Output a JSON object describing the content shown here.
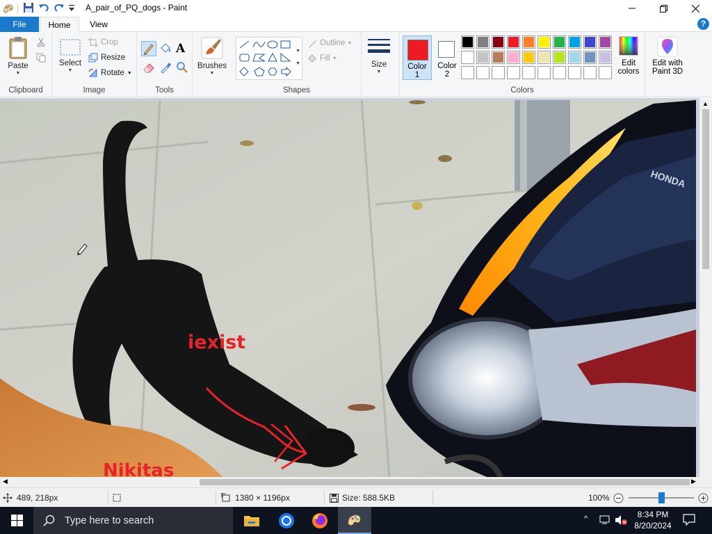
{
  "window": {
    "title": "A_pair_of_PQ_dogs - Paint"
  },
  "tabs": {
    "file": "File",
    "home": "Home",
    "view": "View",
    "help": "?"
  },
  "ribbon": {
    "clipboard": {
      "paste": "Paste",
      "group": "Clipboard"
    },
    "image": {
      "select": "Select",
      "crop": "Crop",
      "resize": "Resize",
      "rotate": "Rotate",
      "group": "Image"
    },
    "tools": {
      "group": "Tools",
      "text_tool": "A"
    },
    "brushes": {
      "label": "Brushes"
    },
    "shapes": {
      "outline": "Outline",
      "fill": "Fill",
      "group": "Shapes"
    },
    "size": {
      "label": "Size"
    },
    "colors": {
      "color1": "Color\n1",
      "color1_line1": "Color",
      "color1_line2": "1",
      "color2_line1": "Color",
      "color2_line2": "2",
      "edit_colors_line1": "Edit",
      "edit_colors_line2": "colors",
      "group": "Colors",
      "color1_value": "#ed1c24",
      "color2_value": "#ffffff",
      "palette_row1": [
        "#000000",
        "#7f7f7f",
        "#880015",
        "#ed1c24",
        "#ff7f27",
        "#fff200",
        "#22b14c",
        "#00a2e8",
        "#3f48cc",
        "#a349a4"
      ],
      "palette_row2": [
        "#ffffff",
        "#c3c3c3",
        "#b97a57",
        "#ffaec9",
        "#ffc90e",
        "#efe4b0",
        "#b5e61d",
        "#99d9ea",
        "#7092be",
        "#c8bfe7"
      ],
      "palette_row3": [
        "#ffffff",
        "#ffffff",
        "#ffffff",
        "#ffffff",
        "#ffffff",
        "#ffffff",
        "#ffffff",
        "#ffffff",
        "#ffffff",
        "#ffffff"
      ]
    },
    "paint3d": {
      "line1": "Edit with",
      "line2": "Paint 3D"
    }
  },
  "canvas": {
    "annotation_1": "iexist",
    "annotation_2": "Nikitas",
    "annotation_color": "#e8232a"
  },
  "statusbar": {
    "cursor_pos": "489, 218px",
    "dimensions": "1380 × 1196px",
    "size": "Size: 588.5KB",
    "zoom": "100%",
    "zoom_slider_level": 0.5
  },
  "taskbar": {
    "search_placeholder": "Type here to search",
    "time": "8:34 PM",
    "date": "8/20/2024"
  }
}
